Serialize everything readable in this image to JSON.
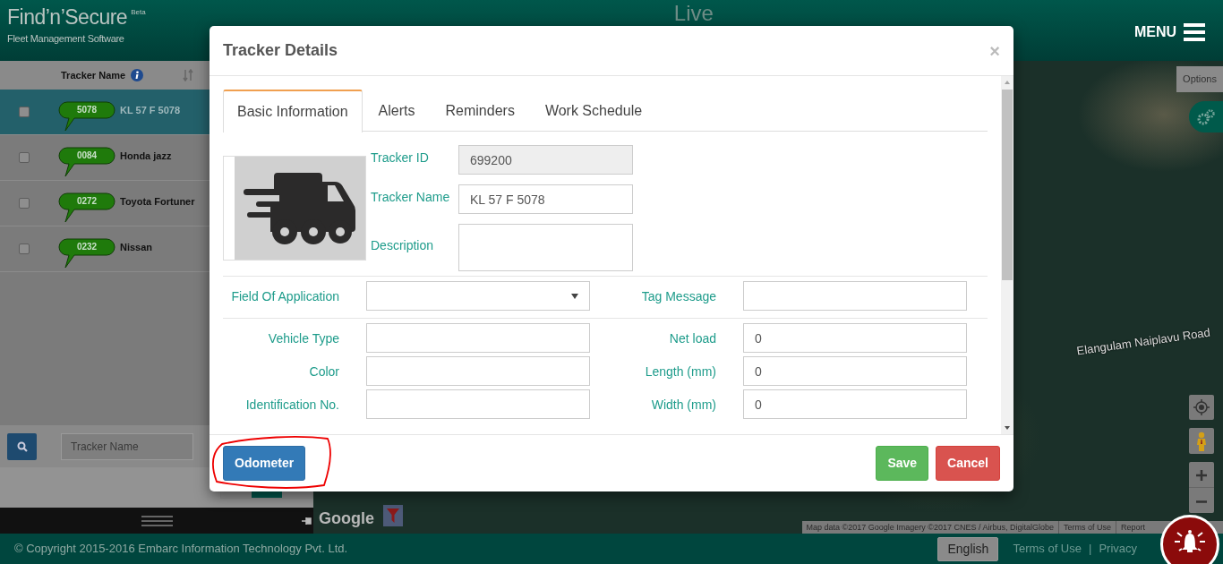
{
  "header": {
    "logo": "Find’n’Secure",
    "logo_badge": "Beta",
    "tagline": "Fleet Management Software",
    "page_title": "Live",
    "menu": "MENU"
  },
  "tracker_list": {
    "column": "Tracker Name",
    "search_placeholder": "Tracker Name",
    "rows": [
      {
        "badge": "5078",
        "name": "KL 57 F 5078",
        "selected": true,
        "checked": false
      },
      {
        "badge": "0084",
        "name": "Honda jazz",
        "selected": false,
        "checked": false
      },
      {
        "badge": "0272",
        "name": "Toyota Fortuner",
        "selected": false,
        "checked": false
      },
      {
        "badge": "0232",
        "name": "Nissan",
        "selected": false,
        "checked": false
      }
    ]
  },
  "map": {
    "road_label": "Elangulam Naiplavu Road",
    "options_button": "Options",
    "google_logo": "Google",
    "attribution": "Map data ©2017 Google Imagery ©2017 CNES / Airbus, DigitalGlobe",
    "attribution_links": [
      "Terms of Use",
      "Report"
    ]
  },
  "modal": {
    "title": "Tracker Details",
    "close": "×",
    "tabs": [
      {
        "label": "Basic Information",
        "selected": true
      },
      {
        "label": "Alerts",
        "selected": false
      },
      {
        "label": "Reminders",
        "selected": false
      },
      {
        "label": "Work Schedule",
        "selected": false
      }
    ],
    "main_fields": [
      {
        "label": "Tracker ID",
        "kind": "readonly",
        "value": "699200"
      },
      {
        "label": "Tracker Name",
        "kind": "text",
        "value": "KL 57 F 5078"
      },
      {
        "label": "Description",
        "kind": "textarea"
      }
    ],
    "sections": [
      [
        {
          "label": "Field Of Application",
          "kind": "select"
        },
        {
          "label": "Tag Message",
          "kind": "text"
        }
      ],
      [
        {
          "label": "Vehicle Type",
          "kind": "text"
        },
        {
          "label": "Net load",
          "kind": "text",
          "value": "0"
        },
        {
          "label": "Color",
          "kind": "text"
        },
        {
          "label": "Length (mm)",
          "kind": "text",
          "value": "0"
        },
        {
          "label": "Identification No.",
          "kind": "text"
        },
        {
          "label": "Width (mm)",
          "kind": "text",
          "value": "0"
        }
      ]
    ],
    "footer_left": [
      {
        "label": "Odometer",
        "kind": "primary"
      }
    ],
    "footer_right": [
      {
        "label": "Save",
        "kind": "success"
      },
      {
        "label": "Cancel",
        "kind": "danger"
      }
    ]
  },
  "footer": {
    "copyright": "© Copyright 2015-2016 Embarc Information Technology Pvt. Ltd.",
    "language": "English",
    "links": [
      "Terms of Use",
      "Privacy"
    ],
    "separator": "|"
  }
}
